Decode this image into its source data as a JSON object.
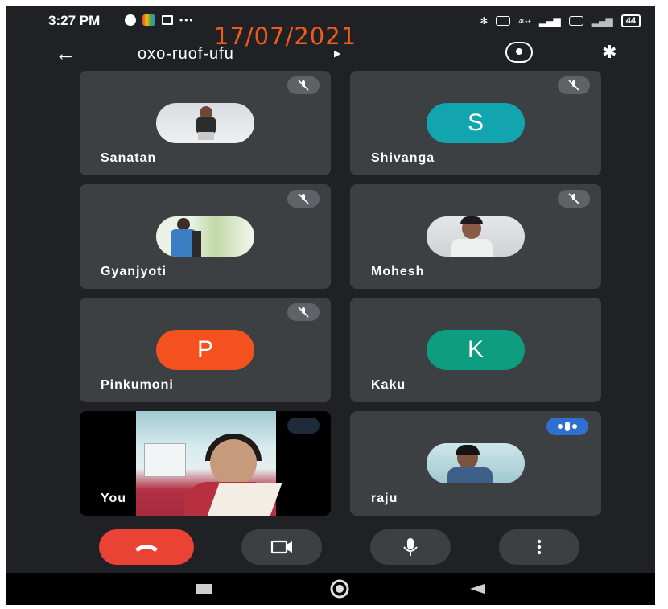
{
  "status_bar": {
    "time": "3:27 PM",
    "battery": "44",
    "network": "4G+"
  },
  "date_overlay": "17/07/2021",
  "header": {
    "meeting_code": "oxo-ruof-ufu"
  },
  "participants": [
    {
      "name": "Sanatan",
      "avatar": "photo",
      "muted": true
    },
    {
      "name": "Shivanga",
      "avatar": "S",
      "color": "#12a4af",
      "muted": true
    },
    {
      "name": "Gyanjyoti",
      "avatar": "photo",
      "muted": true
    },
    {
      "name": "Mohesh",
      "avatar": "photo",
      "muted": true
    },
    {
      "name": "Pinkumoni",
      "avatar": "P",
      "color": "#f4511e",
      "muted": true
    },
    {
      "name": "Kaku",
      "avatar": "K",
      "color": "#0f9d81",
      "muted": false
    },
    {
      "name": "You",
      "avatar": "video",
      "muted": false
    },
    {
      "name": "raju",
      "avatar": "photo",
      "muted": false,
      "speaking": true
    }
  ],
  "controls": [
    "end-call-icon",
    "video-camera-icon",
    "microphone-icon",
    "more-options-icon"
  ],
  "colors": {
    "background": "#202124",
    "tile": "#3c4043",
    "end_call": "#ea4335",
    "date_text": "#f25a1b"
  }
}
